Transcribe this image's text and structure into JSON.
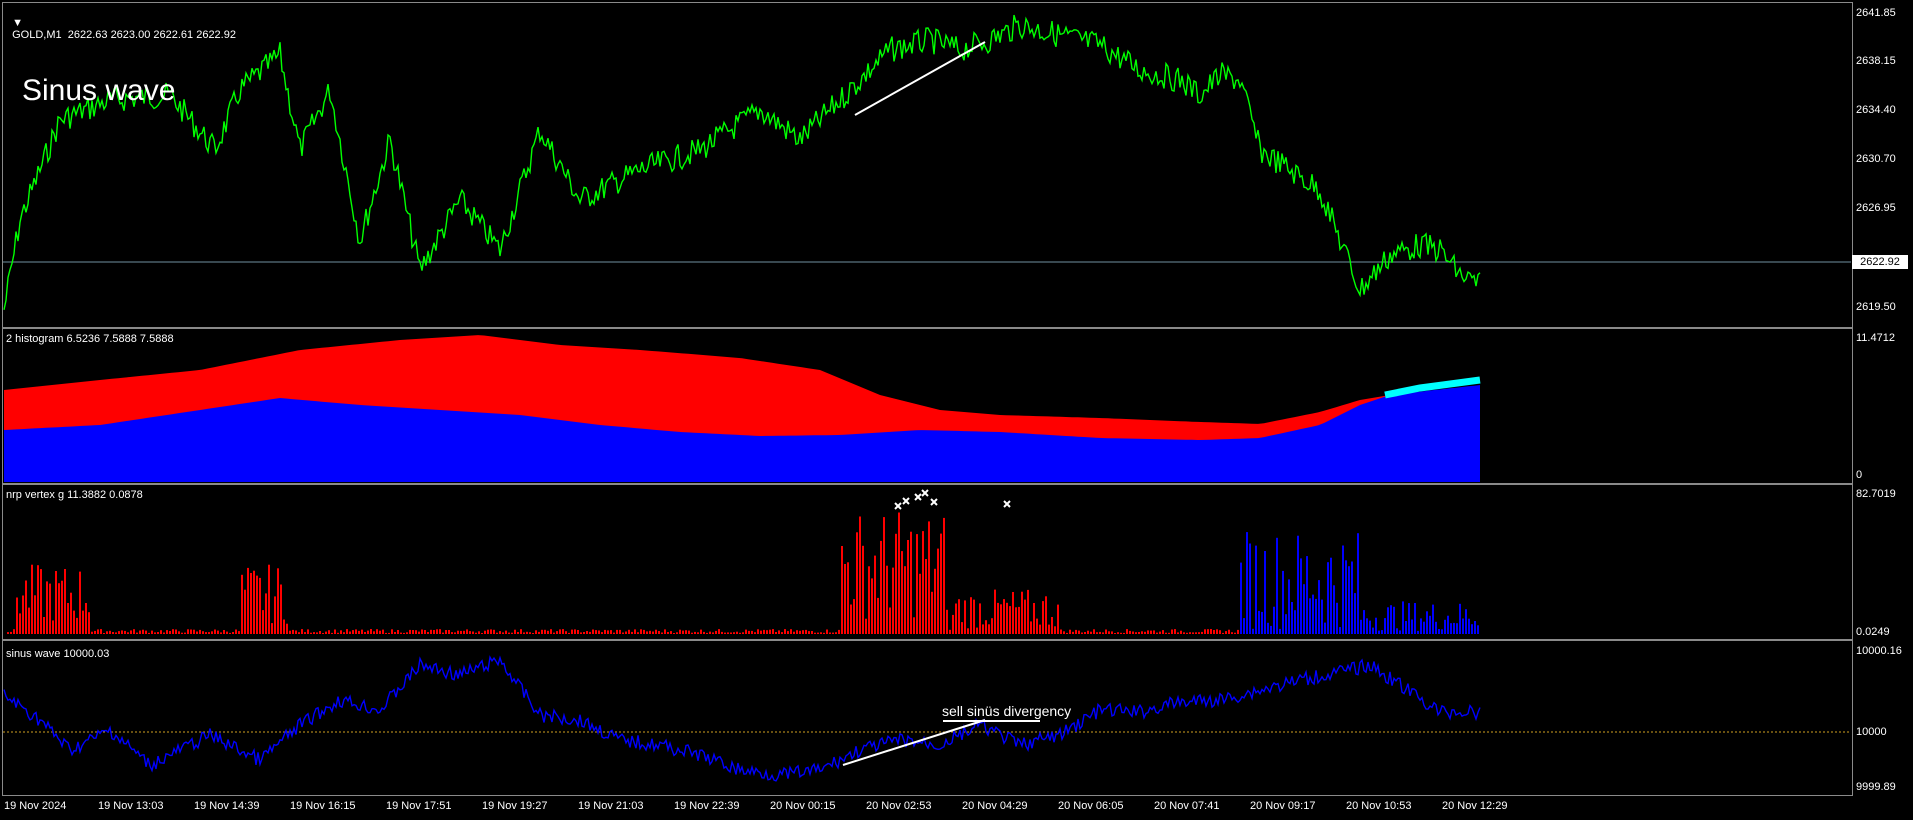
{
  "main": {
    "header": "GOLD,M1  2622.63 2623.00 2622.61 2622.92",
    "overlay_title": "Sinus wave",
    "price_ticks": [
      "2641.85",
      "2638.15",
      "2634.40",
      "2630.70",
      "2626.95",
      "2619.50"
    ],
    "current_price": "2622.92",
    "line_color": "#00ff00"
  },
  "histogram": {
    "header": "2 histogram 6.5236 7.5888 7.5888",
    "scale_top": "11.4712",
    "scale_bottom": "0",
    "colors": {
      "upper": "#ff0000",
      "lower": "#0000ff",
      "accent": "#00ffff"
    }
  },
  "vertex": {
    "header": "nrp vertex g 11.3882 0.0878",
    "scale_top": "82.7019",
    "scale_bottom": "0.0249",
    "colors": {
      "sell": "#ff0000",
      "buy": "#0000ff"
    }
  },
  "sinus": {
    "header": "sinus wave 10000.03",
    "scale_ticks": [
      "10000.16",
      "10000",
      "9999.89"
    ],
    "annotation": "sell sinüs divergency",
    "line_color": "#0000ff"
  },
  "time_axis": [
    "19 Nov 2024",
    "19 Nov 13:03",
    "19 Nov 14:39",
    "19 Nov 16:15",
    "19 Nov 17:51",
    "19 Nov 19:27",
    "19 Nov 21:03",
    "19 Nov 22:39",
    "20 Nov 00:15",
    "20 Nov 02:53",
    "20 Nov 04:29",
    "20 Nov 06:05",
    "20 Nov 07:41",
    "20 Nov 09:17",
    "20 Nov 10:53",
    "20 Nov 12:29"
  ]
}
